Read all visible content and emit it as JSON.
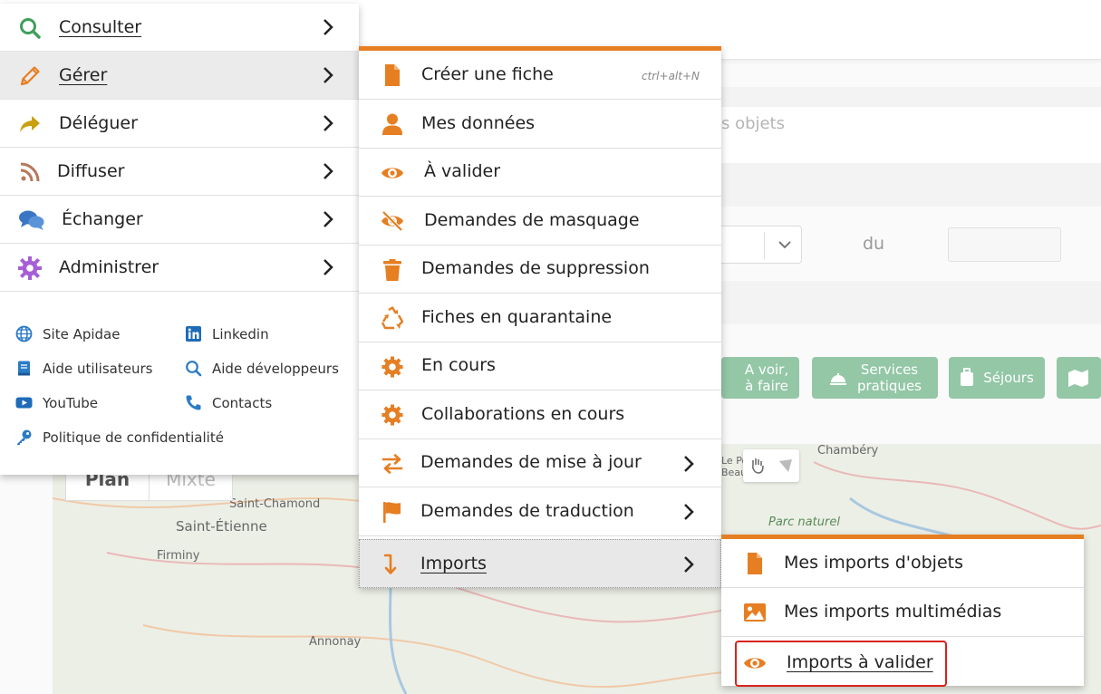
{
  "colors": {
    "accent": "#e67e22",
    "category_button": "#93c7a6",
    "highlight": "#d9231f"
  },
  "background": {
    "search_placeholder_fragment": "s objets",
    "du_label": "du",
    "categories": [
      {
        "label": "A voir,\nà faire",
        "icon": "hiker-icon"
      },
      {
        "label": "Services\npratiques",
        "icon": "bell-icon"
      },
      {
        "label": "Séjours",
        "icon": "luggage-icon"
      },
      {
        "label": "",
        "icon": "map-icon"
      }
    ],
    "map": {
      "tabs": [
        "Plan",
        "Mixte"
      ],
      "places": [
        "Saint-Chamond",
        "Saint-Étienne",
        "Firminy",
        "Annonay",
        "Chambéry",
        "Parc naturel",
        "Le Po",
        "Beau"
      ]
    }
  },
  "menu_main": {
    "items": [
      {
        "label": "Consulter",
        "icon": "search-icon"
      },
      {
        "label": "Gérer",
        "icon": "pencil-icon"
      },
      {
        "label": "Déléguer",
        "icon": "share-arrow-icon"
      },
      {
        "label": "Diffuser",
        "icon": "rss-icon"
      },
      {
        "label": "Échanger",
        "icon": "comments-icon"
      },
      {
        "label": "Administrer",
        "icon": "gear-icon"
      }
    ],
    "links": [
      {
        "label": "Site Apidae",
        "icon": "globe-icon"
      },
      {
        "label": "Linkedin",
        "icon": "linkedin-icon"
      },
      {
        "label": "Aide utilisateurs",
        "icon": "book-icon"
      },
      {
        "label": "Aide développeurs",
        "icon": "search-icon"
      },
      {
        "label": "YouTube",
        "icon": "youtube-icon"
      },
      {
        "label": "Contacts",
        "icon": "phone-icon"
      },
      {
        "label": "Politique de confidentialité",
        "icon": "key-icon"
      }
    ]
  },
  "menu_gerer": {
    "items": [
      {
        "label": "Créer une fiche",
        "icon": "file-icon",
        "shortcut": "ctrl+alt+N"
      },
      {
        "label": "Mes données",
        "icon": "user-icon"
      },
      {
        "label": "À valider",
        "icon": "eye-icon"
      },
      {
        "label": "Demandes de masquage",
        "icon": "eye-slash-icon"
      },
      {
        "label": "Demandes de suppression",
        "icon": "trash-icon"
      },
      {
        "label": "Fiches en quarantaine",
        "icon": "recycle-icon"
      },
      {
        "label": "En cours",
        "icon": "gear-icon"
      },
      {
        "label": "Collaborations en cours",
        "icon": "gear-icon"
      },
      {
        "label": "Demandes de mise à jour",
        "icon": "exchange-icon"
      },
      {
        "label": "Demandes de traduction",
        "icon": "flag-icon"
      },
      {
        "label": "Imports",
        "icon": "level-down-icon"
      }
    ]
  },
  "menu_imports": {
    "items": [
      {
        "label": "Mes imports d'objets",
        "icon": "file-icon"
      },
      {
        "label": "Mes imports multimédias",
        "icon": "image-icon"
      },
      {
        "label": "Imports à valider",
        "icon": "eye-icon"
      }
    ]
  }
}
